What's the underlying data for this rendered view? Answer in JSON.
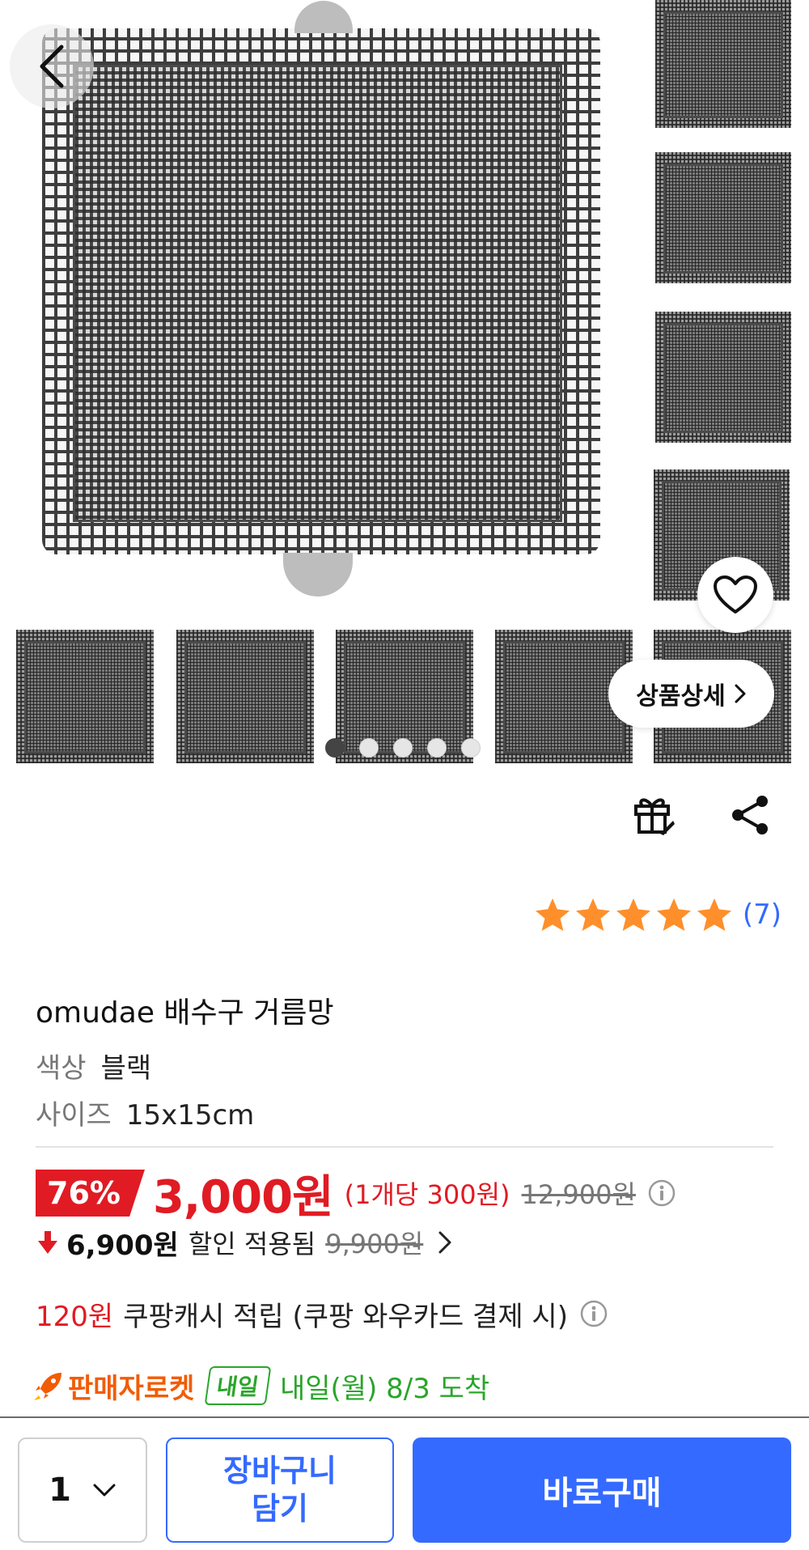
{
  "gallery": {
    "detail_label": "상품상세",
    "dots_count": 5,
    "active_dot": 0
  },
  "rating": {
    "stars": 5,
    "count": "(7)",
    "star_color": "#ff8f2b"
  },
  "product": {
    "title": "omudae 배수구 거름망",
    "options": [
      {
        "key": "색상",
        "value": "블랙"
      },
      {
        "key": "사이즈",
        "value": "15x15cm"
      }
    ]
  },
  "price": {
    "discount_badge": "76%",
    "sale_price": "3,000원",
    "unit_price": "(1개당 300원)",
    "original_price": "12,900원"
  },
  "discount": {
    "amount": "6,900원",
    "text": "할인 적용됨",
    "before_price": "9,900원"
  },
  "cash": {
    "amount": "120원",
    "text": "쿠팡캐시 적립 (쿠팡 와우카드 결제 시)"
  },
  "shipping": {
    "label": "판매자로켓",
    "badge": "내일",
    "arrival": "내일(월) 8/3 도착"
  },
  "bottom_bar": {
    "quantity": "1",
    "cart_line1": "장바구니",
    "cart_line2": "담기",
    "buy_label": "바로구매"
  },
  "colors": {
    "accent_blue": "#346aff",
    "sale_red": "#e01b24",
    "delivery_green": "#2aa52a",
    "rocket_orange": "#f25c05"
  }
}
